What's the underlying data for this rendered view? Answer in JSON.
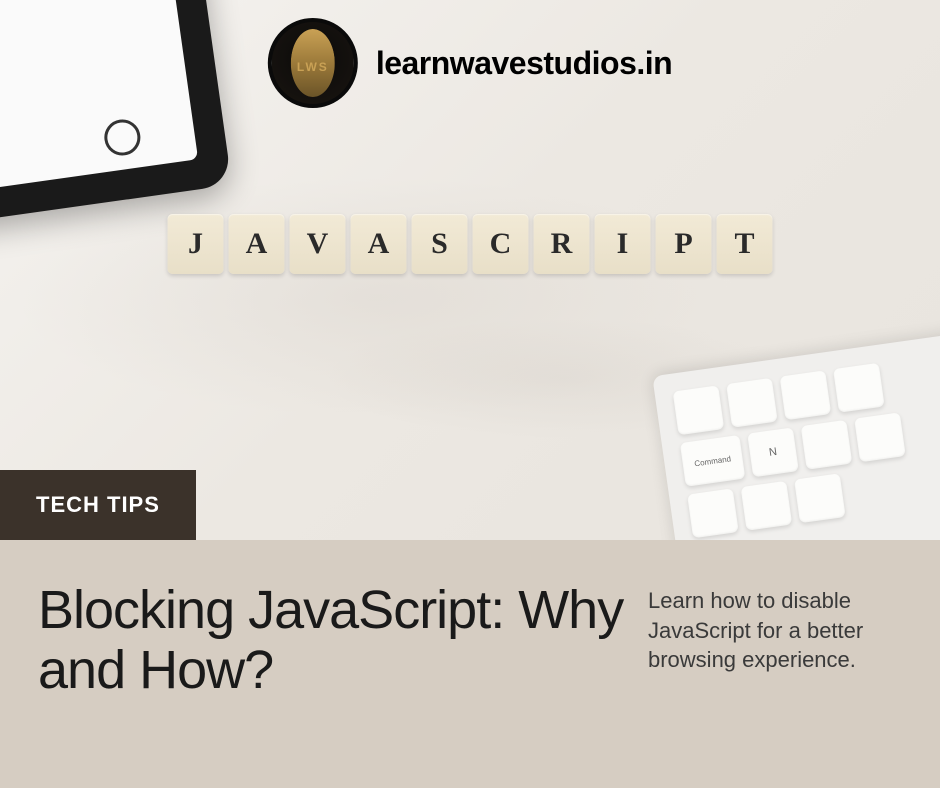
{
  "brand": {
    "name": "learnwavestudios.in",
    "logo_label": "LWS"
  },
  "hero": {
    "tiles": [
      "J",
      "A",
      "V",
      "A",
      "S",
      "C",
      "R",
      "I",
      "P",
      "T"
    ],
    "category": "TECH TIPS"
  },
  "keyboard_hint_keys": [
    "Command",
    "N",
    "",
    "",
    ""
  ],
  "article": {
    "title": "Blocking JavaScript: Why and How?",
    "subtitle": "Learn how to disable JavaScript for a better browsing experience."
  }
}
